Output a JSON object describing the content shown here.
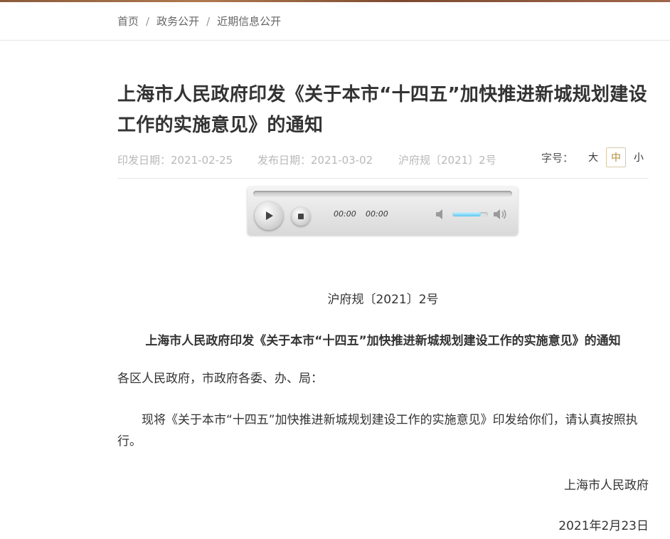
{
  "breadcrumb": {
    "items": [
      "首页",
      "政务公开",
      "近期信息公开"
    ],
    "separator": "/"
  },
  "article": {
    "title": "上海市人民政府印发《关于本市“十四五”加快推进新城规划建设工作的实施意见》的通知",
    "issue_date": "印发日期：2021-02-25",
    "publish_date": "发布日期：2021-03-02",
    "doc_number": "沪府规〔2021〕2号"
  },
  "font_size": {
    "label": "字号：",
    "options": [
      "大",
      "中",
      "小"
    ],
    "selected": "中"
  },
  "audio_player": {
    "current_time": "00:00",
    "duration": "00:00",
    "progress": 0,
    "volume": 0.8
  },
  "body": {
    "doc_number": "沪府规〔2021〕2号",
    "heading": "上海市人民政府印发《关于本市“十四五”加快推进新城规划建设工作的实施意见》的通知",
    "salutation": "各区人民政府，市政府各委、办、局：",
    "paragraph": "现将《关于本市“十四五”加快推进新城规划建设工作的实施意见》印发给你们，请认真按照执行。",
    "signature": "上海市人民政府",
    "date": "2021年2月23日"
  },
  "colors": {
    "accent": "#b38a3a",
    "text": "#333333",
    "meta": "#b8b8b8"
  }
}
